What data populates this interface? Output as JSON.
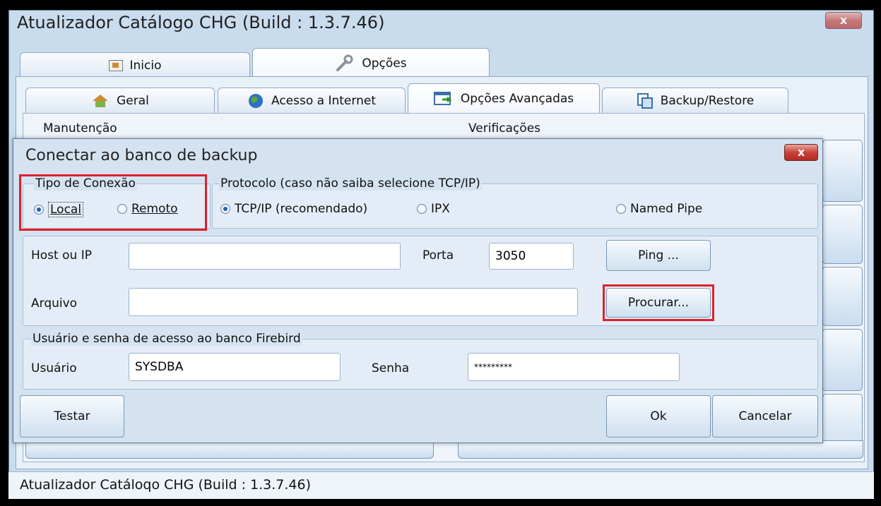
{
  "window": {
    "title": "Atualizador Catálogo CHG  (Build : 1.3.7.46)",
    "close_label": "x"
  },
  "main_tabs": [
    {
      "label": "Inicio"
    },
    {
      "label": "Opções"
    }
  ],
  "sub_tabs": [
    {
      "label": "Geral"
    },
    {
      "label": "Acesso a Internet"
    },
    {
      "label": "Opções Avançadas"
    },
    {
      "label": "Backup/Restore"
    }
  ],
  "groups": {
    "left": "Manutenção",
    "right": "Verificações"
  },
  "status_bar": {
    "text": "Atualizador Catáloqo CHG  (Build : 1.3.7.46)"
  },
  "dialog": {
    "title": "Conectar ao banco de backup",
    "close_label": "x",
    "connection_type": {
      "legend": "Tipo de Conexão",
      "options": [
        {
          "label": "Local",
          "selected": true
        },
        {
          "label": "Remoto",
          "selected": false
        }
      ]
    },
    "protocol": {
      "legend": "Protocolo (caso não saiba selecione TCP/IP)",
      "options": [
        {
          "label": "TCP/IP (recomendado)",
          "selected": true
        },
        {
          "label": "IPX",
          "selected": false
        },
        {
          "label": "Named Pipe",
          "selected": false
        }
      ]
    },
    "host_label": "Host ou IP",
    "host_value": "",
    "port_label": "Porta",
    "port_value": "3050",
    "ping_label": "Ping ...",
    "file_label": "Arquivo",
    "file_value": "",
    "browse_label": "Procurar...",
    "credentials_legend": "Usuário e senha de acesso ao banco Firebird",
    "user_label": "Usuário",
    "user_value": "SYSDBA",
    "password_label": "Senha",
    "password_value": "*********",
    "test_label": "Testar",
    "ok_label": "Ok",
    "cancel_label": "Cancelar"
  },
  "colors": {
    "highlight": "#e0202a",
    "window_bg": "#c9dcee",
    "dialog_bg": "#d5e3f1"
  }
}
